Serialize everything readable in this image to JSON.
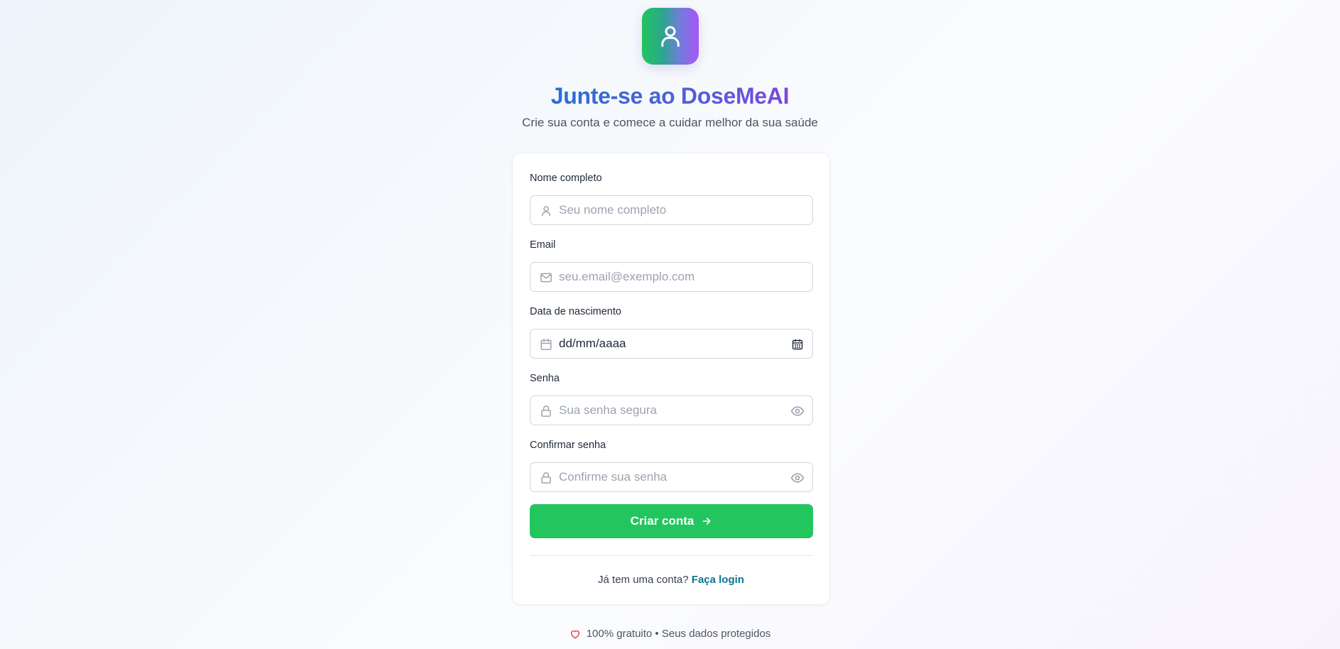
{
  "header": {
    "logo_icon": "user-icon",
    "title": "Junte-se ao DoseMeAI",
    "subtitle": "Crie sua conta e comece a cuidar melhor da sua saúde"
  },
  "form": {
    "fields": [
      {
        "label": "Nome completo",
        "placeholder": "Seu nome completo",
        "icon": "user-icon"
      },
      {
        "label": "Email",
        "placeholder": "seu.email@exemplo.com",
        "icon": "mail-icon"
      },
      {
        "label": "Data de nascimento",
        "value": "dd/mm/aaaa",
        "icon": "calendar-icon",
        "trailing_icon": "calendar-picker-icon"
      },
      {
        "label": "Senha",
        "placeholder": "Sua senha segura",
        "icon": "lock-icon",
        "trailing_icon": "eye-icon"
      },
      {
        "label": "Confirmar senha",
        "placeholder": "Confirme sua senha",
        "icon": "lock-icon",
        "trailing_icon": "eye-icon"
      }
    ],
    "submit_label": "Criar conta",
    "submit_icon": "arrow-right-icon",
    "login_prompt": "Já tem uma conta?",
    "login_link": "Faça login"
  },
  "footer": {
    "icon": "heart-icon",
    "text": "100% gratuito • Seus dados protegidos"
  },
  "colors": {
    "primary_green": "#22c55e",
    "title_gradient_start": "#2a6fd1",
    "title_gradient_end": "#7b48df",
    "link": "#0e7490",
    "heart": "#ef4444"
  }
}
